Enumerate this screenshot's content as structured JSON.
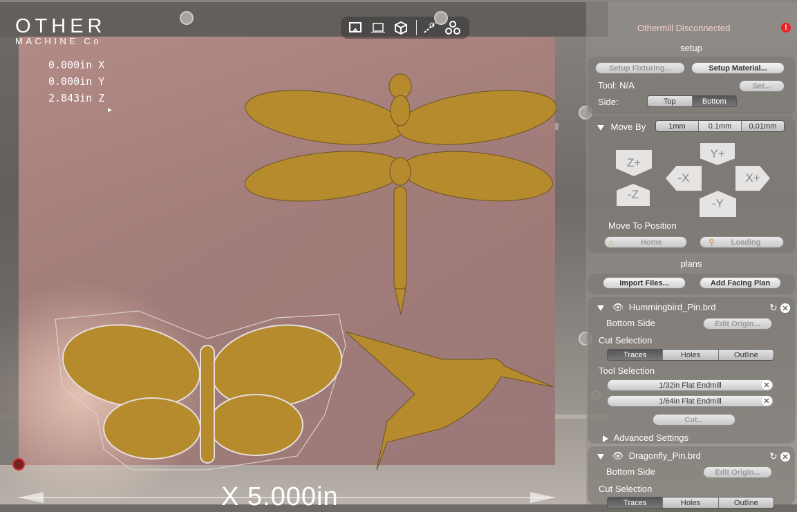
{
  "logo": {
    "line1": "OTHER",
    "line2": "MACHINE Co"
  },
  "coords": {
    "x": "0.000in X",
    "y": "0.000in Y",
    "z": "2.843in Z",
    "caret": "▶"
  },
  "toolbar": {
    "icons": [
      "bookmark-icon",
      "frame-icon",
      "cube-icon",
      "measure-icon",
      "nodes-icon"
    ]
  },
  "dimension": {
    "label": "X 5.000in"
  },
  "status": {
    "text": "Othermill Disconnected",
    "warn": "!"
  },
  "setup": {
    "title": "setup",
    "fixturing_label": "Setup Fixturing...",
    "material_label": "Setup Material...",
    "tool_label": "Tool: N/A",
    "set_label": "Set...",
    "side_label": "Side:",
    "side_options": [
      "Top",
      "Bottom"
    ],
    "side_selected": "Bottom"
  },
  "move": {
    "title": "Move By",
    "steps": [
      "1mm",
      "0.1mm",
      "0.01mm"
    ],
    "step_selected": "0.1mm",
    "z_plus": "Z+",
    "z_minus": "-Z",
    "y_plus": "Y+",
    "y_minus": "-Y",
    "x_plus": "X+",
    "x_minus": "-X",
    "position_title": "Move To Position",
    "home_label": "Home",
    "loading_label": "Loading"
  },
  "plans": {
    "title": "plans",
    "import_label": "Import Files...",
    "facing_label": "Add Facing Plan",
    "files": [
      {
        "name": "Hummingbird_Pin.brd",
        "side": "Bottom Side",
        "edit_origin": "Edit Origin...",
        "cut_selection_title": "Cut Selection",
        "cuts": [
          "Traces",
          "Holes",
          "Outline"
        ],
        "cut_selected": "Traces",
        "tool_selection_title": "Tool Selection",
        "tools": [
          "1/32in Flat Endmill",
          "1/64in Flat Endmill"
        ],
        "cut_button": "Cut...",
        "advanced": "Advanced Settings"
      },
      {
        "name": "Dragonfly_Pin.brd",
        "side": "Bottom Side",
        "edit_origin": "Edit Origin...",
        "cut_selection_title": "Cut Selection",
        "cuts": [
          "Traces",
          "Holes",
          "Outline"
        ],
        "cut_selected": "Traces"
      }
    ]
  },
  "colors": {
    "gold": "#b58b2e",
    "stage": "#a47d7a",
    "alert": "#e22222"
  }
}
